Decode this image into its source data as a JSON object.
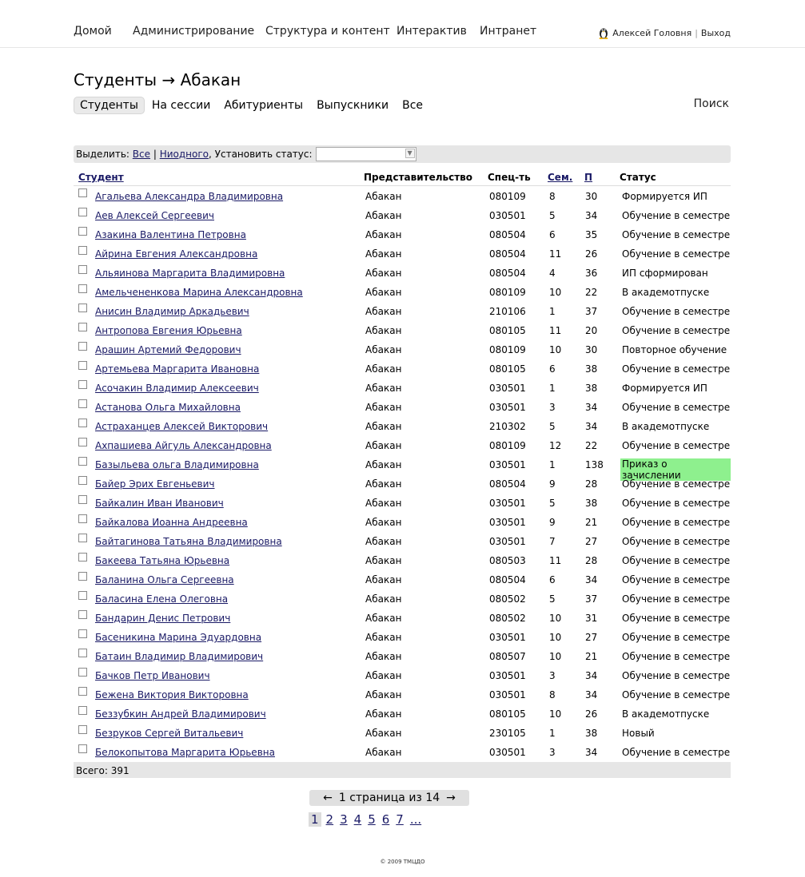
{
  "nav": {
    "items": [
      "Домой",
      "Администрирование",
      "Структура и контент",
      "Интерактив",
      "Интранет"
    ],
    "user": "Алексей Головня",
    "separator": "|",
    "logout": "Выход"
  },
  "title": "Студенты → Абакан",
  "subtabs": [
    "Студенты",
    "На сессии",
    "Абитуриенты",
    "Выпускники",
    "Все"
  ],
  "search": "Поиск",
  "actions": {
    "select_label": "Выделить:",
    "all": "Все",
    "sep": "|",
    "none": "Ниодного",
    "comma": ",",
    "set_status": "Установить статус:",
    "status_value": ""
  },
  "table": {
    "headers": {
      "student": "Студент",
      "rep": "Представительство",
      "spec": "Спец-ть",
      "sem": "Сем.",
      "p": "П",
      "status": "Статус"
    },
    "rows": [
      {
        "name": "Агальева Александра Владимировна",
        "rep": "Абакан",
        "spec": "080109",
        "sem": "8",
        "p": "30",
        "status": "Формируется ИП"
      },
      {
        "name": "Аев Алексей Сергеевич",
        "rep": "Абакан",
        "spec": "030501",
        "sem": "5",
        "p": "34",
        "status": "Обучение в семестре"
      },
      {
        "name": "Азакина Валентина Петровна",
        "rep": "Абакан",
        "spec": "080504",
        "sem": "6",
        "p": "35",
        "status": "Обучение в семестре"
      },
      {
        "name": "Айрина Евгения Александровна",
        "rep": "Абакан",
        "spec": "080504",
        "sem": "11",
        "p": "26",
        "status": "Обучение в семестре"
      },
      {
        "name": "Альяинова Маргарита Владимировна",
        "rep": "Абакан",
        "spec": "080504",
        "sem": "4",
        "p": "36",
        "status": "ИП сформирован"
      },
      {
        "name": "Амельчененкова Марина Александровна",
        "rep": "Абакан",
        "spec": "080109",
        "sem": "10",
        "p": "22",
        "status": "В академотпуске"
      },
      {
        "name": "Анисин Владимир Аркадьевич",
        "rep": "Абакан",
        "spec": "210106",
        "sem": "1",
        "p": "37",
        "status": "Обучение в семестре"
      },
      {
        "name": "Антропова Евгения Юрьевна",
        "rep": "Абакан",
        "spec": "080105",
        "sem": "11",
        "p": "20",
        "status": "Обучение в семестре"
      },
      {
        "name": "Арашин Артемий Федорович",
        "rep": "Абакан",
        "spec": "080109",
        "sem": "10",
        "p": "30",
        "status": "Повторное обучение"
      },
      {
        "name": "Артемьева Маргарита Ивановна",
        "rep": "Абакан",
        "spec": "080105",
        "sem": "6",
        "p": "38",
        "status": "Обучение в семестре"
      },
      {
        "name": "Асочакин Владимир Алексеевич",
        "rep": "Абакан",
        "spec": "030501",
        "sem": "1",
        "p": "38",
        "status": "Формируется ИП"
      },
      {
        "name": "Астанова Ольга Михайловна",
        "rep": "Абакан",
        "spec": "030501",
        "sem": "3",
        "p": "34",
        "status": "Обучение в семестре"
      },
      {
        "name": "Астраханцев Алексей Викторович",
        "rep": "Абакан",
        "spec": "210302",
        "sem": "5",
        "p": "34",
        "status": "В академотпуске"
      },
      {
        "name": "Ахпашиева Айгуль Александровна",
        "rep": "Абакан",
        "spec": "080109",
        "sem": "12",
        "p": "22",
        "status": "Обучение в семестре"
      },
      {
        "name": "Базыльева ольга Владимировна",
        "rep": "Абакан",
        "spec": "030501",
        "sem": "1",
        "p": "138",
        "status": "Приказ о зачислении",
        "highlight": true
      },
      {
        "name": "Байер Эрих Евгеньевич",
        "rep": "Абакан",
        "spec": "080504",
        "sem": "9",
        "p": "28",
        "status": "Обучение в семестре"
      },
      {
        "name": "Байкалин Иван Иванович",
        "rep": "Абакан",
        "spec": "030501",
        "sem": "5",
        "p": "38",
        "status": "Обучение в семестре"
      },
      {
        "name": "Байкалова Иоанна Андреевна",
        "rep": "Абакан",
        "spec": "030501",
        "sem": "9",
        "p": "21",
        "status": "Обучение в семестре"
      },
      {
        "name": "Байтагинова Татьяна Владимировна",
        "rep": "Абакан",
        "spec": "030501",
        "sem": "7",
        "p": "27",
        "status": "Обучение в семестре"
      },
      {
        "name": "Бакеева Татьяна Юрьевна",
        "rep": "Абакан",
        "spec": "080503",
        "sem": "11",
        "p": "28",
        "status": "Обучение в семестре"
      },
      {
        "name": "Баланина Ольга Сергеевна",
        "rep": "Абакан",
        "spec": "080504",
        "sem": "6",
        "p": "34",
        "status": "Обучение в семестре"
      },
      {
        "name": "Баласина Елена Олеговна",
        "rep": "Абакан",
        "spec": "080502",
        "sem": "5",
        "p": "37",
        "status": "Обучение в семестре"
      },
      {
        "name": "Бандарин Денис Петрович",
        "rep": "Абакан",
        "spec": "080502",
        "sem": "10",
        "p": "31",
        "status": "Обучение в семестре"
      },
      {
        "name": "Басеникина Марина Эдуардовна",
        "rep": "Абакан",
        "spec": "030501",
        "sem": "10",
        "p": "27",
        "status": "Обучение в семестре"
      },
      {
        "name": "Батаин Владимир Владимирович",
        "rep": "Абакан",
        "spec": "080507",
        "sem": "10",
        "p": "21",
        "status": "Обучение в семестре"
      },
      {
        "name": "Бачков Петр Иванович",
        "rep": "Абакан",
        "spec": "030501",
        "sem": "3",
        "p": "34",
        "status": "Обучение в семестре"
      },
      {
        "name": "Бежена Виктория Викторовна",
        "rep": "Абакан",
        "spec": "030501",
        "sem": "8",
        "p": "34",
        "status": "Обучение в семестре"
      },
      {
        "name": "Беззубкин Андрей Владимирович",
        "rep": "Абакан",
        "spec": "080105",
        "sem": "10",
        "p": "26",
        "status": "В академотпуске"
      },
      {
        "name": "Безруков Сергей Витальевич",
        "rep": "Абакан",
        "spec": "230105",
        "sem": "1",
        "p": "38",
        "status": "Новый"
      },
      {
        "name": "Белокопытова Маргарита Юрьевна",
        "rep": "Абакан",
        "spec": "030501",
        "sem": "3",
        "p": "34",
        "status": "Обучение в семестре"
      }
    ],
    "total": "Всего: 391"
  },
  "pager": {
    "prev": "←",
    "label": "1 страница из 14",
    "next": "→",
    "current": "1",
    "pages": [
      "2",
      "3",
      "4",
      "5",
      "6",
      "7",
      "..."
    ]
  },
  "copyright": "© 2009 ТМЦДО",
  "colors": {
    "highlight": "#8ef08e",
    "bar": "#e6e6e6",
    "link": "#1a1a66"
  }
}
